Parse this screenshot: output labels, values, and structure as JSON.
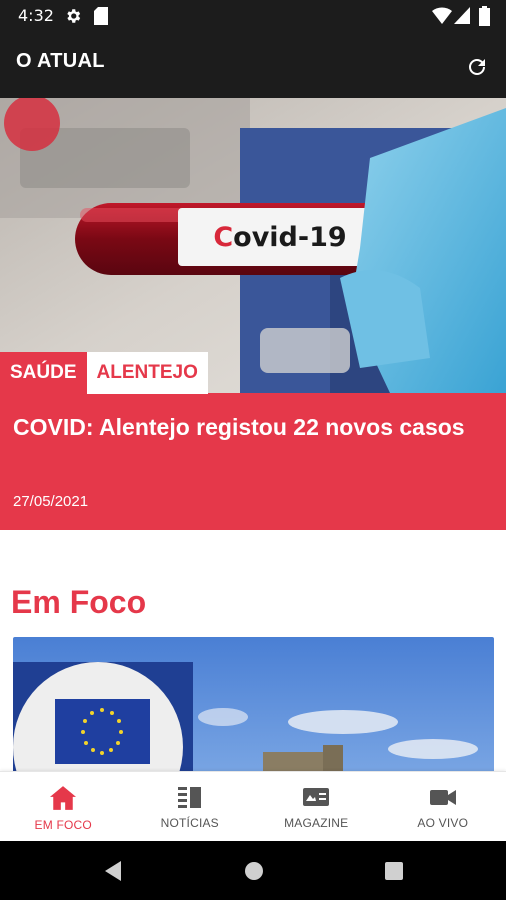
{
  "status_bar": {
    "time": "4:32",
    "icons": [
      "gear-icon",
      "sd-card-icon",
      "wifi-icon",
      "signal-icon",
      "battery-icon"
    ]
  },
  "app_bar": {
    "title": "O ATUAL",
    "refresh_icon": "refresh-icon"
  },
  "hero": {
    "image_label": "Covid-19",
    "tags": [
      "SAÚDE",
      "ALENTEJO"
    ],
    "title": "COVID: Alentejo registou 22 novos casos",
    "date": "27/05/2021"
  },
  "section": {
    "title": "Em Foco"
  },
  "bottom_nav": {
    "items": [
      {
        "label": "EM FOCO",
        "icon": "home-icon",
        "active": true
      },
      {
        "label": "NOTÍCIAS",
        "icon": "news-icon",
        "active": false
      },
      {
        "label": "MAGAZINE",
        "icon": "magazine-icon",
        "active": false
      },
      {
        "label": "AO VIVO",
        "icon": "video-camera-icon",
        "active": false
      }
    ]
  },
  "colors": {
    "accent": "#e5384a",
    "app_bar": "#1c1c1c"
  }
}
